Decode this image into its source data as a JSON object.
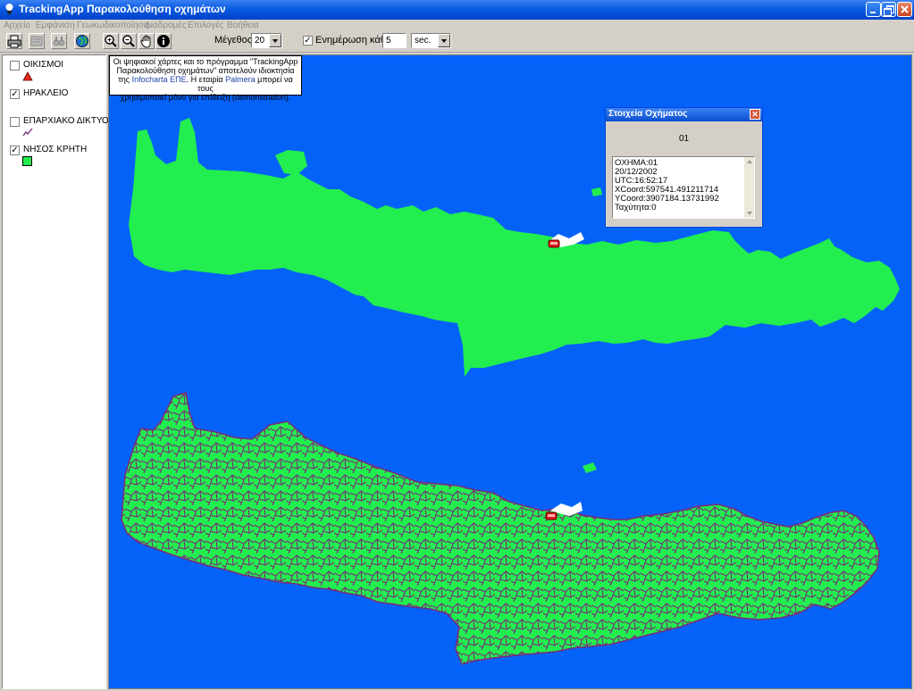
{
  "window": {
    "title": "TrackingApp Παρακολούθηση οχημάτων",
    "controls": [
      "minimize",
      "maximize",
      "close"
    ]
  },
  "menu": [
    "Αρχείο",
    "Εμφάνιση",
    "Γεωκωδικοποίηση",
    "Διαδρομές",
    "Επιλογές",
    "Βοήθεια"
  ],
  "toolbar": {
    "buttons": [
      "print-icon",
      "layers-icon",
      "binoculars-icon",
      "globe-icon",
      "zoom-in-icon",
      "zoom-out-icon",
      "pan-hand-icon",
      "info-icon"
    ],
    "size_label": "Μέγεθος",
    "size_value": "20",
    "update_checked": true,
    "update_label": "Ενημέρωση κάθε",
    "interval_value": "5",
    "unit_value": "sec."
  },
  "legend": {
    "layers": [
      {
        "label": "ΟΙΚΙΣΜΟΙ",
        "checked": false,
        "symbol": "red-triangle"
      },
      {
        "label": "ΗΡΑΚΛΕΙΟ",
        "checked": true,
        "symbol": "none"
      },
      {
        "label": "ΕΠΑΡΧΙΑΚΟ ΔΙΚΤΥΟ",
        "checked": false,
        "symbol": "purple-line"
      },
      {
        "label": "ΝΗΣΟΣ ΚΡΗΤΗ",
        "checked": true,
        "symbol": "green-square"
      }
    ]
  },
  "notice": {
    "line1": "Οι ψηφιακοί χάρτες και το πρόγραμμα \"TrackingApp",
    "line2": "Παρακολούθηση οχημάτων\" αποτελούν ιδιοκτησία",
    "line3_pre": "της ",
    "line3_company": "Infocharta ΕΠΕ",
    "line3_mid": ". Η εταιρία ",
    "line3_company2": "Palmera",
    "line3_post": " μπορεί να τους",
    "line4": "χρησιμοποιεί μόνο για επίδειξη (demonstration)."
  },
  "dialog": {
    "title": "Στοιχεία Οχήματος",
    "vehicle_id": "01",
    "lines": [
      "ΟΧΗΜΑ:01",
      "20/12/2002",
      "UTC:16:52:17",
      "XCoord:597541.491211714",
      "YCoord:3907184.13731992",
      "Ταχύτητα:0"
    ]
  },
  "colors": {
    "sea": "#0562f8",
    "land": "#22ee4f",
    "roads": "#7a2a7a",
    "city": "#ffffff",
    "vehicle": "#e01818"
  }
}
